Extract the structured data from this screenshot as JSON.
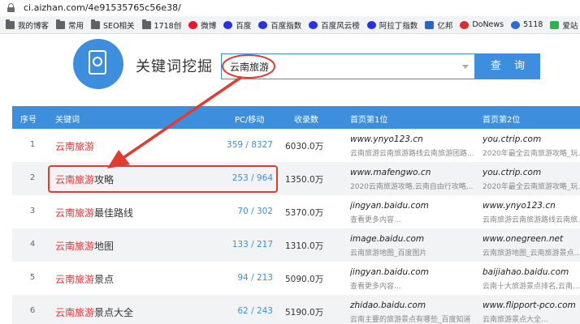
{
  "browser": {
    "url": "ci.aizhan.com/4e91535765c56e38/",
    "bookmarks": [
      "我的博客",
      "常用",
      "SEO相关",
      "1718创",
      "微博",
      "百度",
      "百度指数",
      "百度风云榜",
      "阿拉丁指数",
      "亿邦",
      "DoNews",
      "5118",
      "爱站"
    ]
  },
  "header": {
    "title": "关键词挖掘",
    "search_value": "云南旅游",
    "search_button": "查 询"
  },
  "table": {
    "columns": [
      "序号",
      "关键词",
      "PC/移动",
      "收录数",
      "首页第1位",
      "首页第2位"
    ],
    "rows": [
      {
        "idx": "1",
        "kw_red": "云南旅游",
        "kw_rest": "",
        "pc": "359 / 8327",
        "inc": "6030.0万",
        "u1": "www.ynyo123.cn",
        "d1": "云南旅游云南旅游路线云南旅游团路...",
        "u2": "you.ctrip.com",
        "d2": "2020年最全云南旅游攻略_玩..."
      },
      {
        "idx": "2",
        "kw_red": "云南旅游",
        "kw_rest": "攻略",
        "pc": "253 / 964",
        "inc": "1350.0万",
        "u1": "www.mafengwo.cn",
        "d1": "2020云南旅游攻略,云南自由行攻略,...",
        "u2": "you.ctrip.com",
        "d2": "2020年最全云南旅游攻略_玩..."
      },
      {
        "idx": "3",
        "kw_red": "云南旅游",
        "kw_rest": "最佳路线",
        "pc": "70 / 302",
        "inc": "5370.0万",
        "u1": "jingyan.baidu.com",
        "d1": "查看更多内容...",
        "u2": "www.ynyo123.cn",
        "d2": "云南旅游云南旅游路线云南旅..."
      },
      {
        "idx": "4",
        "kw_red": "云南旅游",
        "kw_rest": "地图",
        "pc": "133 / 217",
        "inc": "1310.0万",
        "u1": "image.baidu.com",
        "d1": "云南旅游地图_百度图片",
        "u2": "www.onegreen.net",
        "d2": "云南旅游地图_云南旅游景点..."
      },
      {
        "idx": "5",
        "kw_red": "云南旅游",
        "kw_rest": "景点",
        "pc": "94 / 213",
        "inc": "5090.0万",
        "u1": "jingyan.baidu.com",
        "d1": "查看更多内容...",
        "u2": "baijiahao.baidu.com",
        "d2": "云南十大旅游景点排名,云南..."
      },
      {
        "idx": "6",
        "kw_red": "云南旅游",
        "kw_rest": "景点大全",
        "pc": "62 / 243",
        "inc": "5190.0万",
        "u1": "zhidao.baidu.com",
        "d1": "云南主要的旅游景点有哪些_百度知道",
        "u2": "www.flipport-pco.com",
        "d2": "云南旅游景点大全..."
      }
    ]
  },
  "colors": {
    "brand": "#3d8fde",
    "highlight": "#e4393c",
    "annotation": "#e03c31"
  }
}
